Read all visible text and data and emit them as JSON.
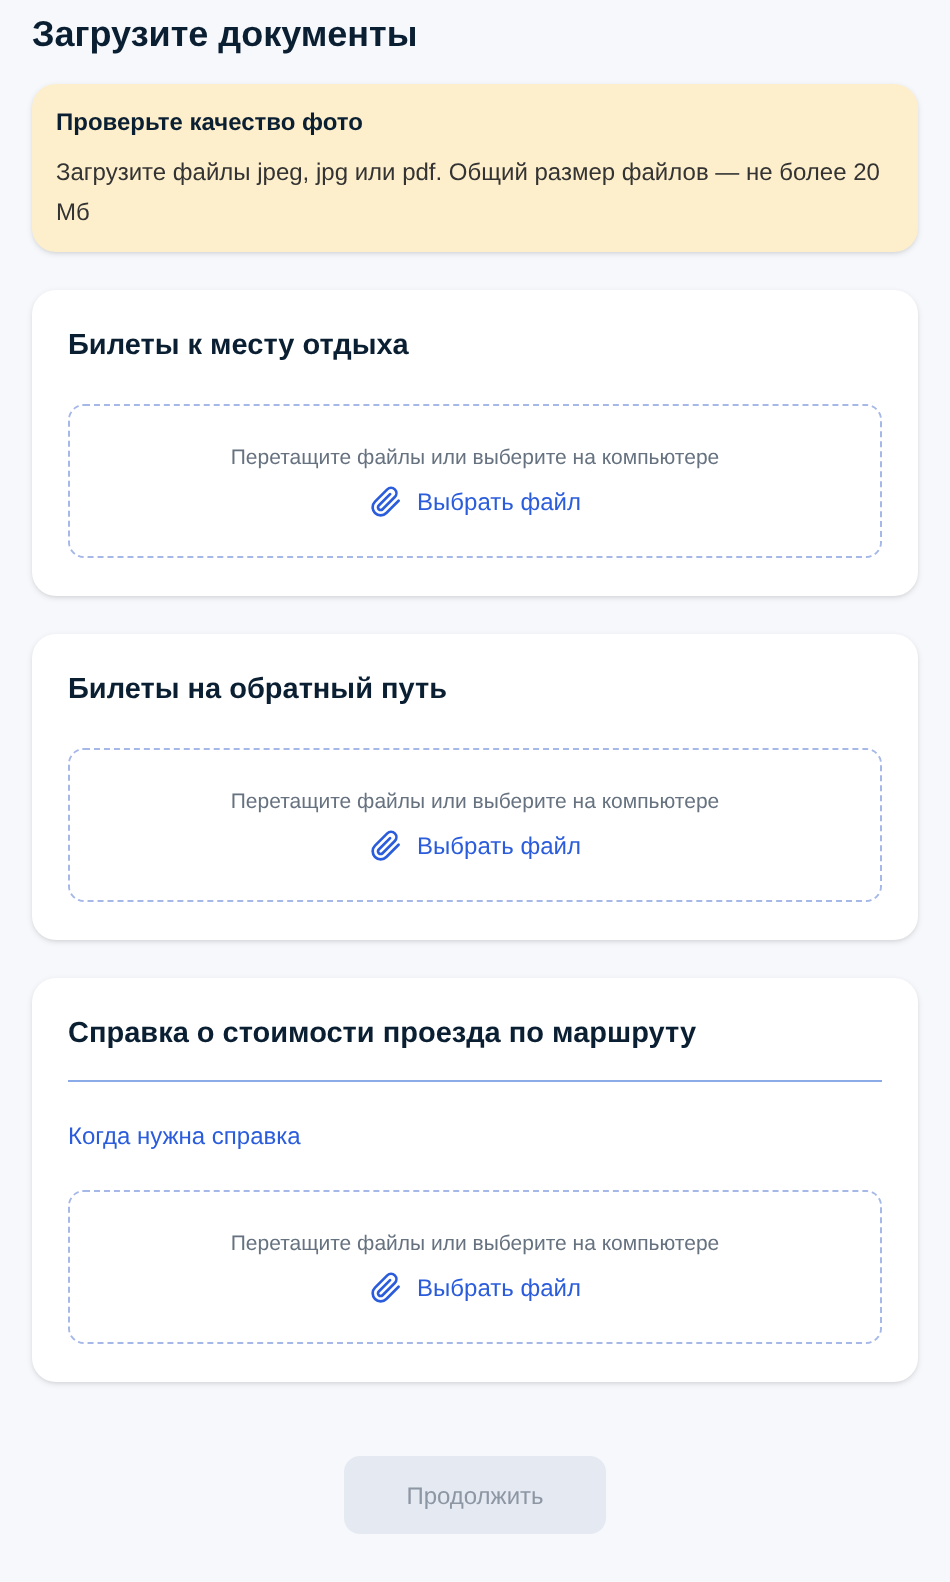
{
  "title": "Загрузите документы",
  "notice": {
    "title": "Проверьте качество фото",
    "text": "Загрузите файлы jpeg, jpg или pdf. Общий размер файлов — не более 20 Мб"
  },
  "sections": [
    {
      "title": "Билеты к месту отдыха",
      "dropzone": {
        "hint": "Перетащите файлы или выберите на компьютере",
        "action": "Выбрать файл"
      }
    },
    {
      "title": "Билеты на обратный путь",
      "dropzone": {
        "hint": "Перетащите файлы или выберите на компьютере",
        "action": "Выбрать файл"
      }
    },
    {
      "title": "Справка о стоимости проезда по маршруту",
      "link": "Когда нужна справка",
      "dropzone": {
        "hint": "Перетащите файлы или выберите на компьютере",
        "action": "Выбрать файл"
      }
    }
  ],
  "continue_button": {
    "label": "Продолжить",
    "disabled": true
  }
}
